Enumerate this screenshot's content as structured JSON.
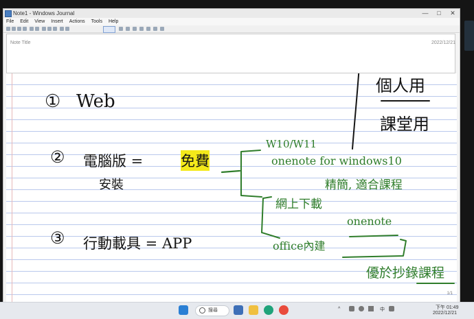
{
  "window": {
    "title": "Note1 - Windows Journal",
    "controls": [
      "—",
      "□",
      "✕"
    ]
  },
  "menu": [
    "File",
    "Edit",
    "View",
    "Insert",
    "Actions",
    "Tools",
    "Help"
  ],
  "note": {
    "title_label": "Note Title",
    "date": "2022/12/21",
    "page_number": "1/1"
  },
  "ink": {
    "item1_num": "①",
    "item1_text": "Web",
    "item2_num": "②",
    "item2_text": "電腦版 = ",
    "item2_highlight": "免費",
    "item2_sub": "安裝",
    "item3_num": "③",
    "item3_text": "行動載具 = APP",
    "right_top": "個人用",
    "right_bottom": "課堂用",
    "branch1": "W10/W11",
    "branch2": "onenote for windows10",
    "branch3": "精簡, 適合課程",
    "branch4": "網上下載",
    "branch5": "onenote",
    "branch6": "office內建",
    "branch7": "優於抄錄課程"
  },
  "taskbar": {
    "search_text": "搜尋",
    "time": "下午 01:49",
    "date": "2022/12/21",
    "ime": "中",
    "tray_arrow": "^"
  },
  "colors": {
    "ink_black": "#151515",
    "ink_green": "#2f7d2b",
    "highlight": "#f4e91a",
    "ruled_line": "#b9c8ec"
  }
}
